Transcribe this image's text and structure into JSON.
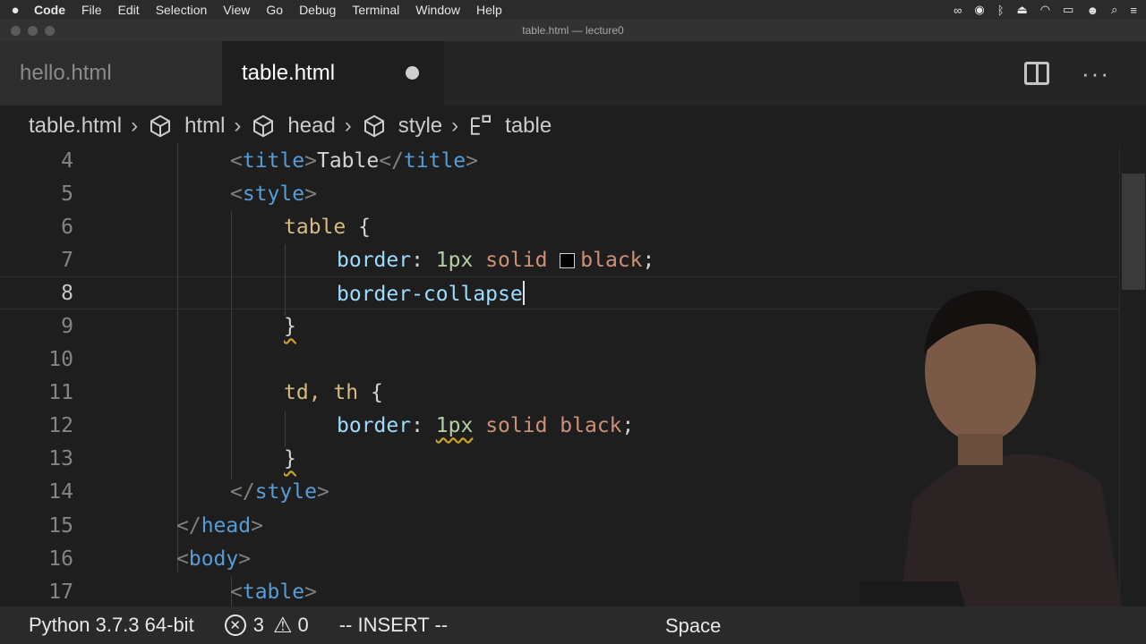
{
  "menubar": {
    "apple": "",
    "items": [
      "Code",
      "File",
      "Edit",
      "Selection",
      "View",
      "Go",
      "Debug",
      "Terminal",
      "Window",
      "Help"
    ],
    "status_icons": [
      "glasses-icon",
      "notification-icon",
      "bluetooth-icon",
      "eject-icon",
      "wifi-icon",
      "battery-icon",
      "user-icon",
      "search-icon",
      "control-center-icon"
    ]
  },
  "window": {
    "title": "table.html — lecture0"
  },
  "tabs": [
    {
      "label": "hello.html",
      "active": false
    },
    {
      "label": "table.html",
      "active": true,
      "dirty": true
    }
  ],
  "breadcrumb": [
    {
      "label": "table.html",
      "icon": ""
    },
    {
      "label": "html",
      "icon": "cube-icon"
    },
    {
      "label": "head",
      "icon": "cube-icon"
    },
    {
      "label": "style",
      "icon": "cube-icon"
    },
    {
      "label": "table",
      "icon": "structure-icon"
    }
  ],
  "editor": {
    "line_numbers": [
      "4",
      "5",
      "6",
      "7",
      "8",
      "9",
      "10",
      "11",
      "12",
      "13",
      "14",
      "15",
      "16",
      "17"
    ],
    "current_line": "8",
    "lines": {
      "l4": {
        "open": "<",
        "tag": "title",
        "close": ">",
        "text": "Table",
        "open2": "</",
        "tag2": "title",
        "close2": ">"
      },
      "l5": {
        "open": "<",
        "tag": "style",
        "close": ">"
      },
      "l6": {
        "selector": "table",
        "brace": " {"
      },
      "l7": {
        "prop": "border",
        "colon": ": ",
        "v1": "1px",
        "v2": " solid ",
        "v3": "black",
        "semi": ";"
      },
      "l8": {
        "prop": "border-collapse"
      },
      "l9": {
        "brace": "}"
      },
      "l11": {
        "selector": "td, th",
        "brace": " {"
      },
      "l12": {
        "prop": "border",
        "colon": ": ",
        "v1": "1px",
        "v2": " solid black",
        "semi": ";"
      },
      "l13": {
        "brace": "}"
      },
      "l14": {
        "open": "</",
        "tag": "style",
        "close": ">"
      },
      "l15": {
        "open": "</",
        "tag": "head",
        "close": ">"
      },
      "l16": {
        "open": "<",
        "tag": "body",
        "close": ">"
      },
      "l17": {
        "open": "<",
        "tag": "table",
        "close": ">"
      }
    }
  },
  "statusbar": {
    "interpreter": "Python 3.7.3 64-bit",
    "errors": "3",
    "warnings": "0",
    "mode": "-- INSERT --",
    "indent": "Space"
  },
  "colors": {
    "editor_bg": "#1e1e1e",
    "tag": "#569cd6",
    "property": "#9cdcfe",
    "value": "#ce9178",
    "number": "#b5cea8",
    "selector": "#d7ba7d"
  }
}
